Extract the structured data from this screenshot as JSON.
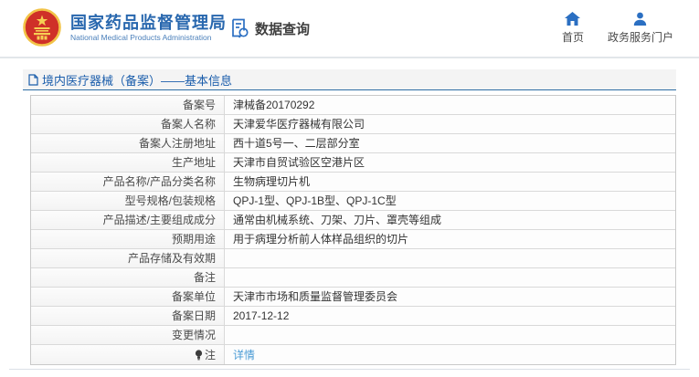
{
  "header": {
    "org_name_cn": "国家药品监督管理局",
    "org_name_en": "National Medical Products Administration",
    "emblem_icon": "china-national-emblem",
    "module": {
      "label": "数据查询",
      "icon": "document-search-icon"
    },
    "nav": [
      {
        "label": "首页",
        "icon": "home-icon"
      },
      {
        "label": "政务服务门户",
        "icon": "user-icon"
      }
    ]
  },
  "section": {
    "icon": "document-icon",
    "title": "境内医疗器械（备案）——基本信息"
  },
  "table": {
    "rows": [
      {
        "label": "备案号",
        "value": "津械备20170292"
      },
      {
        "label": "备案人名称",
        "value": "天津爱华医疗器械有限公司"
      },
      {
        "label": "备案人注册地址",
        "value": "西十道5号一、二层部分室"
      },
      {
        "label": "生产地址",
        "value": "天津市自贸试验区空港片区"
      },
      {
        "label": "产品名称/产品分类名称",
        "value": "生物病理切片机"
      },
      {
        "label": "型号规格/包装规格",
        "value": "QPJ-1型、QPJ-1B型、QPJ-1C型"
      },
      {
        "label": "产品描述/主要组成成分",
        "value": "通常由机械系统、刀架、刀片、罩壳等组成"
      },
      {
        "label": "预期用途",
        "value": "用于病理分析前人体样品组织的切片"
      },
      {
        "label": "产品存储及有效期",
        "value": ""
      },
      {
        "label": "备注",
        "value": ""
      },
      {
        "label": "备案单位",
        "value": "天津市市场和质量监督管理委员会"
      },
      {
        "label": "备案日期",
        "value": "2017-12-12"
      },
      {
        "label": "变更情况",
        "value": ""
      },
      {
        "label": "注",
        "value": "详情",
        "label_icon": "lightbulb-icon",
        "value_is_link": true
      }
    ]
  },
  "colors": {
    "brand_blue": "#2867ae",
    "icon_blue": "#2b6fc2",
    "section_title_blue": "#1a5dab",
    "link_blue": "#4a9bd5",
    "emblem_red": "#cf3028",
    "emblem_gold": "#f2c347",
    "bar_background": "#f4f4f4"
  }
}
